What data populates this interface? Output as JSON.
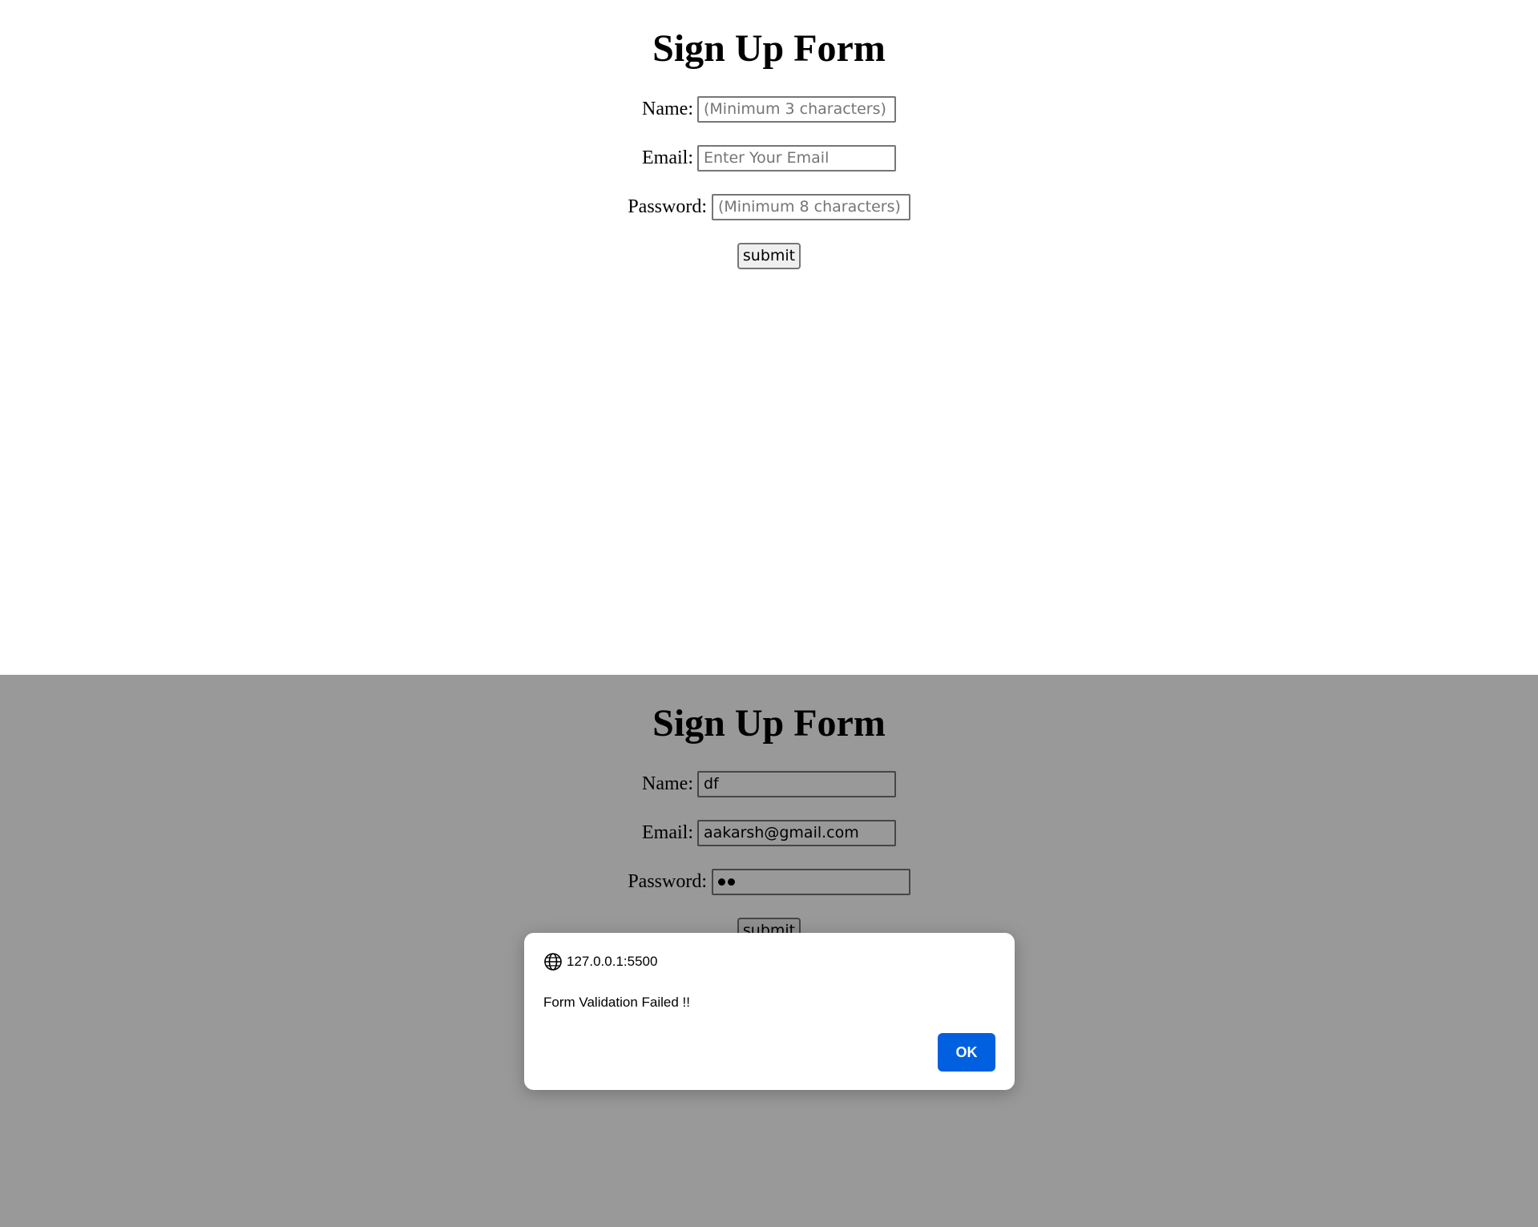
{
  "top_state": {
    "title": "Sign Up Form",
    "name_label": "Name:",
    "name_placeholder": "(Minimum 3 characters)",
    "email_label": "Email:",
    "email_placeholder": "Enter Your Email",
    "password_label": "Password:",
    "password_placeholder": "(Minimum 8 characters)",
    "submit_label": "submit"
  },
  "bottom_state": {
    "title": "Sign Up Form",
    "name_label": "Name:",
    "name_value": "df",
    "email_label": "Email:",
    "email_value": "aakarsh@gmail.com",
    "password_label": "Password:",
    "password_masked_length": 2,
    "submit_label": "submit",
    "dialog": {
      "origin": "127.0.0.1:5500",
      "message": "Form Validation Failed !!",
      "ok_label": "OK",
      "ok_color": "#0060df"
    }
  }
}
